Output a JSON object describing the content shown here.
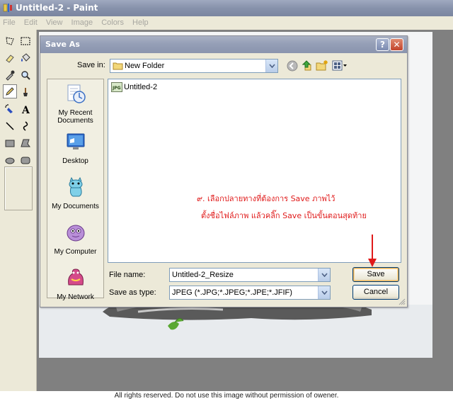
{
  "app": {
    "title": "Untitled-2 - Paint",
    "menu": [
      "File",
      "Edit",
      "View",
      "Image",
      "Colors",
      "Help"
    ]
  },
  "dialog": {
    "title": "Save As",
    "help_glyph": "?",
    "close_glyph": "✕",
    "save_in_label": "Save in:",
    "save_in_value": "New Folder",
    "places": [
      {
        "label": "My Recent Documents",
        "icon": "recent-documents-icon"
      },
      {
        "label": "Desktop",
        "icon": "desktop-icon"
      },
      {
        "label": "My Documents",
        "icon": "my-documents-icon"
      },
      {
        "label": "My Computer",
        "icon": "my-computer-icon"
      },
      {
        "label": "My Network",
        "icon": "my-network-icon"
      }
    ],
    "files": [
      {
        "name": "Untitled-2",
        "icon": "jpeg-file-icon"
      }
    ],
    "file_name_label": "File name:",
    "file_name_value": "Untitled-2_Resize",
    "save_as_type_label": "Save as type:",
    "save_as_type_value": "JPEG (*.JPG;*.JPEG;*.JPE;*.JFIF)",
    "save_button": "Save",
    "cancel_button": "Cancel"
  },
  "annotation": {
    "line1": "๙. เลือกปลายทางที่ต้องการ Save ภาพไว้",
    "line2": "ตั้งชื่อไฟล์ภาพ แล้วคลิ๊ก Save เป็นขั้นตอนสุดท้าย",
    "color": "#e01a1a"
  },
  "footer": "All rights reserved. Do not use this image without permission of owener.",
  "colors": {
    "title_bar": "#8792ab",
    "dialog_bg": "#ece9d8",
    "accent_orange": "#e7b056"
  }
}
